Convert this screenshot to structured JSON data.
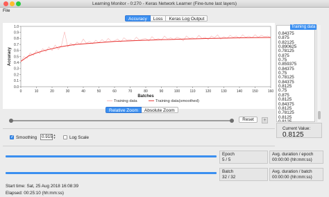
{
  "window": {
    "title": "Learning Monitor - 0:270 - Keras Network Learner (Fine-tune last layers)"
  },
  "menu": {
    "file": "File"
  },
  "tabs": [
    {
      "label": "Accuracy",
      "active": true
    },
    {
      "label": "Loss",
      "active": false
    },
    {
      "label": "Keras Log Output",
      "active": false
    }
  ],
  "chart_data": {
    "type": "line",
    "xlabel": "Batches",
    "ylabel": "Accuracy",
    "xlim": [
      0,
      160
    ],
    "ylim": [
      0.0,
      1.0
    ],
    "xticks": [
      0,
      10,
      20,
      30,
      40,
      50,
      60,
      70,
      80,
      90,
      100,
      110,
      120,
      130,
      140,
      150,
      160
    ],
    "yticks": [
      "0.0",
      "0.1",
      "0.2",
      "0.3",
      "0.4",
      "0.5",
      "0.6",
      "0.7",
      "0.8",
      "0.9",
      "1.0"
    ],
    "grid": false,
    "legend_position": "bottom",
    "series": [
      {
        "name": "Training data",
        "color": "#f7b2b2",
        "x": [
          0,
          2,
          4,
          6,
          8,
          10,
          12,
          14,
          16,
          18,
          20,
          22,
          24,
          26,
          28,
          30,
          32,
          34,
          36,
          38,
          40,
          42,
          44,
          46,
          48,
          50,
          52,
          54,
          56,
          58,
          60,
          62,
          64,
          66,
          68,
          70,
          72,
          74,
          76,
          78,
          80,
          82,
          84,
          86,
          88,
          90,
          92,
          94,
          96,
          98,
          100,
          102,
          104,
          106,
          108,
          110,
          112,
          114,
          116,
          118,
          120,
          122,
          124,
          126,
          128,
          130,
          132,
          134,
          136,
          138,
          140,
          142,
          144,
          146,
          148,
          150,
          152,
          154,
          156,
          158,
          160
        ],
        "y": [
          0.41,
          0.5,
          0.47,
          0.56,
          0.52,
          0.6,
          0.55,
          0.63,
          0.58,
          0.66,
          0.6,
          0.69,
          0.62,
          0.68,
          0.91,
          0.66,
          0.72,
          0.68,
          0.74,
          0.7,
          0.79,
          0.72,
          0.75,
          0.71,
          0.77,
          0.73,
          0.78,
          0.74,
          0.8,
          0.75,
          0.76,
          0.79,
          0.74,
          0.81,
          0.77,
          0.78,
          0.76,
          0.82,
          0.77,
          0.79,
          0.8,
          0.76,
          0.83,
          0.78,
          0.8,
          0.77,
          0.84,
          0.79,
          0.81,
          0.78,
          0.82,
          0.8,
          0.76,
          0.84,
          0.8,
          0.81,
          0.79,
          0.85,
          0.8,
          0.82,
          0.78,
          0.84,
          0.81,
          0.86,
          0.79,
          0.83,
          0.8,
          0.85,
          0.82,
          0.84,
          0.8,
          0.86,
          0.82,
          0.84,
          0.81,
          0.86,
          0.82,
          0.85,
          0.83,
          0.84,
          0.81
        ]
      },
      {
        "name": "Training data(smoothed)",
        "color": "#e8312f",
        "x": [
          0,
          5,
          10,
          15,
          20,
          25,
          30,
          35,
          40,
          45,
          50,
          55,
          60,
          65,
          70,
          75,
          80,
          85,
          90,
          95,
          100,
          105,
          110,
          115,
          120,
          125,
          130,
          135,
          140,
          145,
          150,
          155,
          160
        ],
        "y": [
          0.42,
          0.51,
          0.56,
          0.6,
          0.63,
          0.66,
          0.68,
          0.7,
          0.71,
          0.72,
          0.73,
          0.74,
          0.75,
          0.755,
          0.76,
          0.765,
          0.77,
          0.775,
          0.78,
          0.782,
          0.786,
          0.79,
          0.793,
          0.796,
          0.8,
          0.802,
          0.805,
          0.808,
          0.81,
          0.812,
          0.814,
          0.815,
          0.816
        ]
      }
    ]
  },
  "list": {
    "header": "Training data",
    "items": [
      "0.84375",
      "0.875",
      "0.82125",
      "0.890625",
      "0.78125",
      "0.875",
      "0.75",
      "0.859375",
      "0.84375",
      "0.75",
      "0.78125",
      "0.84375",
      "0.8125",
      "0.75",
      "0.875",
      "0.8125",
      "0.84375",
      "0.8125",
      "0.78125",
      "0.8125",
      "0.8125"
    ]
  },
  "current": {
    "label": "Current Value:",
    "value": "0.8125"
  },
  "zoom": {
    "relative": "Relative Zoom",
    "absolute": "Absolute Zoom",
    "active": "relative"
  },
  "controls": {
    "reset": "Reset",
    "plus": "+",
    "smoothing_label": "Smoothing",
    "smoothing_value": "0.915",
    "smoothing_checked": true,
    "logscale_label": "Log Scale",
    "logscale_checked": false
  },
  "progress": {
    "epoch_label": "Epoch",
    "epoch_value": "5 / 5",
    "epoch_fraction": 1.0,
    "batch_label": "Batch",
    "batch_value": "32 / 32",
    "batch_fraction": 1.0,
    "avg_epoch_label": "Avg. duration / epoch",
    "avg_epoch_value": "00:00:00 (hh:mm:ss)",
    "avg_batch_label": "Avg. duration / batch",
    "avg_batch_value": "00:00:00 (hh:mm:ss)"
  },
  "status": {
    "start": "Start time: Sat, 25 Aug 2018 16:08:39",
    "elapsed": "Elapsed: 00:25:10 (hh:mm:ss)"
  },
  "colors": {
    "accent": "#3b8ff0",
    "raw": "#f7b2b2",
    "smoothed": "#e8312f"
  }
}
